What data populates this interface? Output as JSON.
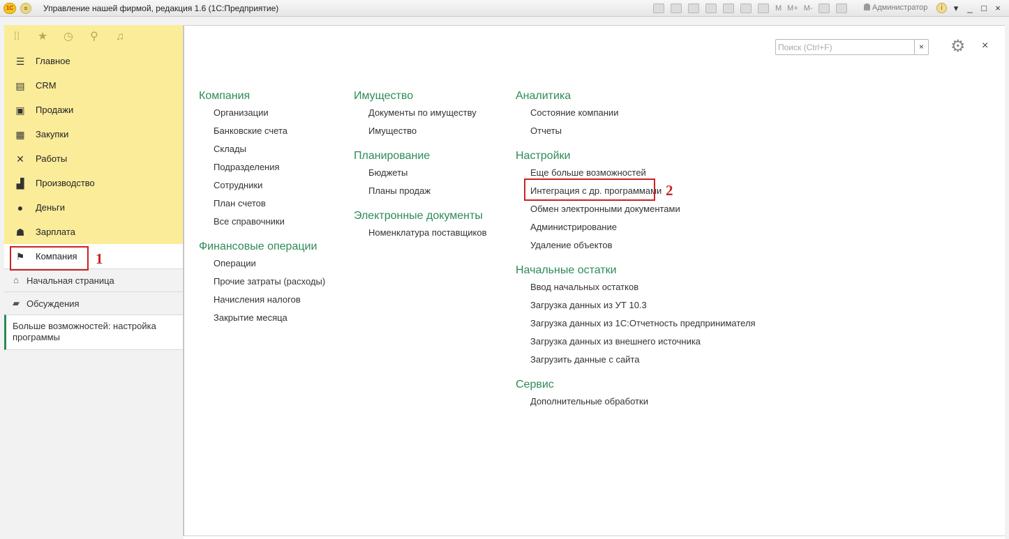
{
  "window": {
    "title": "Управление нашей фирмой, редакция 1.6  (1С:Предприятие)",
    "logo_text": "1С",
    "toolbar_text": [
      "M",
      "M+",
      "M-"
    ],
    "user": "Администратор",
    "info": "i",
    "minimize": "_",
    "maximize": "□",
    "close": "×",
    "dropdown": "▾"
  },
  "sidebar": {
    "toolbar_icons": [
      "apps-grid-icon",
      "star-icon",
      "history-icon",
      "search-icon",
      "bell-icon"
    ],
    "sections": [
      {
        "label": "Главное",
        "icon": "menu-icon"
      },
      {
        "label": "CRM",
        "icon": "crm-icon"
      },
      {
        "label": "Продажи",
        "icon": "cart-icon"
      },
      {
        "label": "Закупки",
        "icon": "purchase-icon"
      },
      {
        "label": "Работы",
        "icon": "tools-icon"
      },
      {
        "label": "Производство",
        "icon": "factory-icon"
      },
      {
        "label": "Деньги",
        "icon": "ruble-icon"
      },
      {
        "label": "Зарплата",
        "icon": "people-icon"
      },
      {
        "label": "Компания",
        "icon": "flag-icon",
        "active": true
      }
    ],
    "nav": [
      {
        "label": "Начальная страница",
        "icon": "home-icon"
      },
      {
        "label": "Обсуждения",
        "icon": "chat-icon"
      }
    ],
    "open_window": "Больше возможностей: настройка программы"
  },
  "annotations": {
    "one": "1",
    "two": "2"
  },
  "main": {
    "search_placeholder": "Поиск (Ctrl+F)",
    "search_clear": "×",
    "close": "×",
    "columns": [
      {
        "groups": [
          {
            "title": "Компания",
            "items": [
              "Организации",
              "Банковские счета",
              "Склады",
              "Подразделения",
              "Сотрудники",
              "План счетов",
              "Все справочники"
            ]
          },
          {
            "title": "Финансовые операции",
            "items": [
              "Операции",
              "Прочие затраты (расходы)",
              "Начисления налогов",
              "Закрытие месяца"
            ]
          }
        ]
      },
      {
        "groups": [
          {
            "title": "Имущество",
            "items": [
              "Документы по имуществу",
              "Имущество"
            ]
          },
          {
            "title": "Планирование",
            "items": [
              "Бюджеты",
              "Планы продаж"
            ]
          },
          {
            "title": "Электронные документы",
            "items": [
              "Номенклатура поставщиков"
            ]
          }
        ]
      },
      {
        "groups": [
          {
            "title": "Аналитика",
            "items": [
              "Состояние компании",
              "Отчеты"
            ]
          },
          {
            "title": "Настройки",
            "items": [
              "Еще больше возможностей",
              "Интеграция с др. программами",
              "Обмен электронными документами",
              "Администрирование",
              "Удаление объектов"
            ]
          },
          {
            "title": "Начальные остатки",
            "items": [
              "Ввод начальных остатков",
              "Загрузка данных из УТ 10.3",
              "Загрузка данных из 1С:Отчетность предпринимателя",
              "Загрузка данных из внешнего источника",
              "Загрузить данные с сайта"
            ]
          },
          {
            "title": "Сервис",
            "items": [
              "Дополнительные обработки"
            ]
          }
        ]
      }
    ]
  }
}
